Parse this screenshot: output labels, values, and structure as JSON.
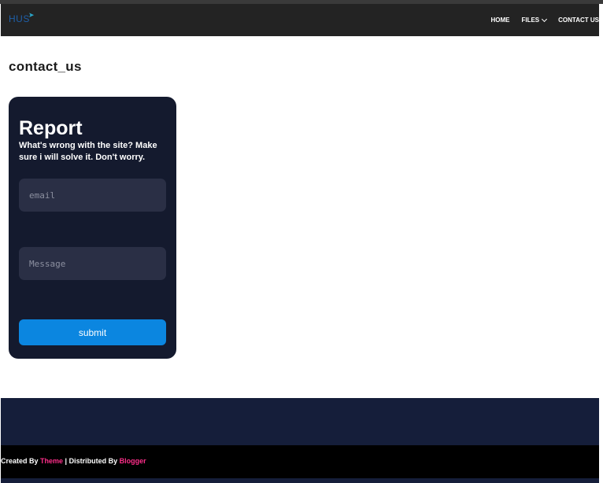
{
  "header": {
    "logo_text": "HUS",
    "nav": [
      {
        "label": "HOME"
      },
      {
        "label": "FILES"
      },
      {
        "label": "CONTACT US"
      }
    ]
  },
  "page": {
    "title": "contact_us"
  },
  "form": {
    "title": "Report",
    "subtitle": "What's wrong with the site? Make sure i will solve it. Don't worry.",
    "email_placeholder": "email",
    "message_placeholder": "Message",
    "submit_label": "submit"
  },
  "footer": {
    "created_by_prefix": "Created By ",
    "theme_link": "Theme",
    "separator": " | Distributed By ",
    "blogger_link": "Blogger"
  },
  "colors": {
    "navbar": "#232323",
    "card": "#141a2e",
    "button": "#0b86e0",
    "footer_link": "#ff2e8a"
  }
}
